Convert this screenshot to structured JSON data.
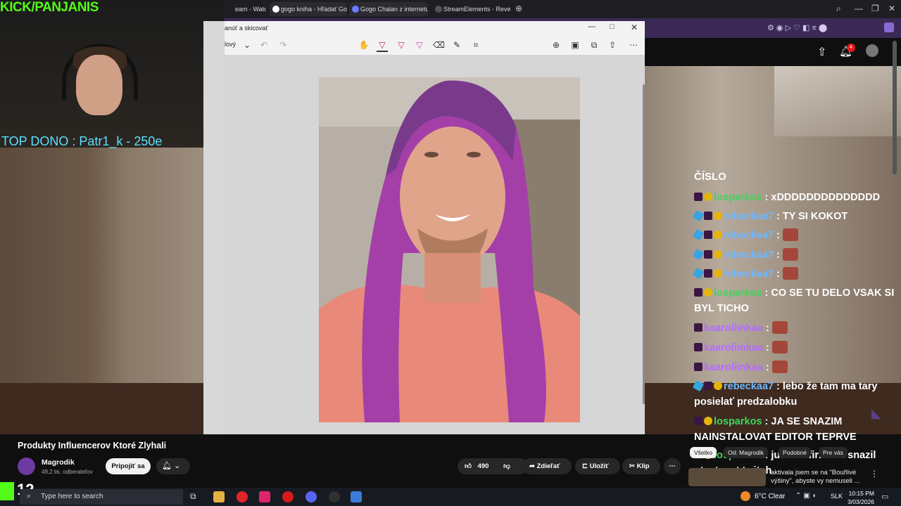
{
  "stream_overlay": {
    "kick_channel": "KICK/PANJANIS",
    "top_donor": "TOP DONO : Patr1_k - 250e",
    "counter": "12"
  },
  "browser_tabs": [
    {
      "label": "eam - Watch l",
      "color": "#3a3a3a"
    },
    {
      "label": "gogo kniha - Hľadať Goo",
      "color": "#ffffff"
    },
    {
      "label": "Gogo Chalan z internetu",
      "color": "#6a7bff"
    },
    {
      "label": "StreamElements - Revenu",
      "color": "#222222"
    }
  ],
  "viewer": {
    "title": "anúť a skicovať",
    "mode_label": "lový",
    "toolbar_icons": [
      "touch-write-icon",
      "pen-red-icon",
      "pen-magenta-icon",
      "pen-pink-icon",
      "eraser-icon",
      "ruler-icon",
      "crop-icon",
      "zoom-in-icon",
      "save-icon",
      "copy-icon",
      "share-icon",
      "more-icon"
    ]
  },
  "chat": {
    "header": "ČÍSLO",
    "messages": [
      {
        "badges": [
          "purple",
          "coin"
        ],
        "user": "losparkos",
        "user_color": "#3ed65a",
        "text": ": xDDDDDDDDDDDDDD",
        "emotes": 0
      },
      {
        "badges": [
          "cube",
          "purple",
          "coin"
        ],
        "user": "rebeckaa7",
        "user_color": "#6fb7ff",
        "text": ": TY SI KOKOT",
        "emotes": 0
      },
      {
        "badges": [
          "cube",
          "purple",
          "coin"
        ],
        "user": "rebeckaa7",
        "user_color": "#6fb7ff",
        "text": ":",
        "emotes": 1
      },
      {
        "badges": [
          "cube",
          "purple",
          "coin"
        ],
        "user": "rebeckaa7",
        "user_color": "#6fb7ff",
        "text": ":",
        "emotes": 1
      },
      {
        "badges": [
          "cube",
          "purple",
          "coin"
        ],
        "user": "rebeckaa7",
        "user_color": "#6fb7ff",
        "text": ":",
        "emotes": 1
      },
      {
        "badges": [
          "purple",
          "coin"
        ],
        "user": "losparkos",
        "user_color": "#3ed65a",
        "text": ": CO SE TU DELO VSAK SI BYL TICHO",
        "emotes": 0
      },
      {
        "badges": [
          "purple"
        ],
        "user": "kaaroliinkaa",
        "user_color": "#b46bff",
        "text": ":",
        "emotes": 1
      },
      {
        "badges": [
          "purple"
        ],
        "user": "kaaroliinkaa",
        "user_color": "#b46bff",
        "text": ":",
        "emotes": 1
      },
      {
        "badges": [
          "purple"
        ],
        "user": "kaaroliinkaa",
        "user_color": "#b46bff",
        "text": ":",
        "emotes": 1
      },
      {
        "badges": [
          "cube",
          "purple",
          "coin"
        ],
        "user": "rebeckaa7",
        "user_color": "#6fb7ff",
        "text": ": lebo že tam ma tary posielať predzalobku",
        "emotes": 0
      },
      {
        "badges": [
          "purple",
          "coin"
        ],
        "user": "losparkos",
        "user_color": "#3ed65a",
        "text": ": JA SE SNAZIM NAINSTALOVAT EDITOR TEPRVE",
        "emotes": 0
      },
      {
        "badges": [
          "purple",
          "coin"
        ],
        "user": "losparkos",
        "user_color": "#3ed65a",
        "text": ": jutuber firko sa snazil otestovat twitch",
        "emotes": 0
      }
    ]
  },
  "youtube": {
    "video_title": "Produkty Influencerov Ktoré Zlyhali",
    "channel_name": "Magrodik",
    "channel_subs": "49,2 tis. odberateľov",
    "join_label": "Pripojiť sa",
    "likes": "490",
    "share_label": "Zdieľať",
    "save_label": "Uložiť",
    "clip_label": "Klip",
    "notifications_count": "4",
    "filter_chips": [
      "Všetko",
      "Od: Magrodik",
      "Podobné",
      "Pre vás"
    ],
    "mini_title": "aktivala jsem se na \"Bouřlivé výšiny\", abyste vy nemuseli ..."
  },
  "taskbar": {
    "search_placeholder": "Type here to search",
    "weather": "6°C Clear",
    "language": "SLK",
    "time": "10:15 PM",
    "date": "3/03/2026"
  }
}
